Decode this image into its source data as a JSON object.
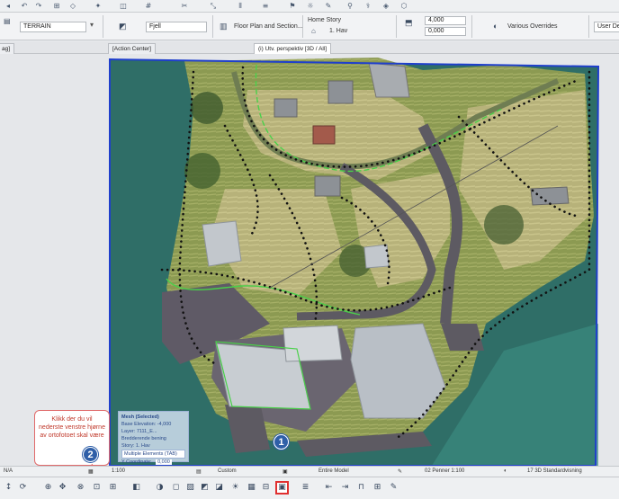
{
  "infobox": {
    "layer_value": "TERRAIN",
    "fill_value": "Fjell",
    "floor_plan_label": "Floor Plan and Section...",
    "home_story_label": "Home Story",
    "home_story_value": "1. Hav",
    "elevation_top": "4,000",
    "elevation_bottom": "0,000",
    "overrides_label": "Various Overrides",
    "user_defined_label": "User Defi"
  },
  "tabs": {
    "left_cut": "ag]",
    "action_center": "[Action Center]",
    "view_3d": "(i) Utv. perspektiv [3D / All]"
  },
  "callout": {
    "text": "Klikk der du vil nederste venstre hjørne av ortofotoet skal være"
  },
  "badges": {
    "one": "1",
    "two": "2"
  },
  "tracker": {
    "line1": "Mesh (Selected)",
    "line2": "Base Elevation: -4,000",
    "line3": "Layer: 7111_E... Bredderende bening",
    "line4": "Story: 1. Hav",
    "line5": "Multiple Elements (TAB)",
    "line6": "Y Coordinate:",
    "line6_value": "0,000"
  },
  "status": {
    "na": "N/A",
    "scale": "1:100",
    "custom": "Custom",
    "entire_model": "Entire Model",
    "pens": "02 Penner 1:100",
    "standard": "17 3D Standardvisning"
  },
  "colors": {
    "water": "#2f6e67",
    "selection": "#1f3fcc",
    "badge": "#2f5fa8",
    "callout_border": "#e06a6a",
    "highlight": "#e03030"
  }
}
